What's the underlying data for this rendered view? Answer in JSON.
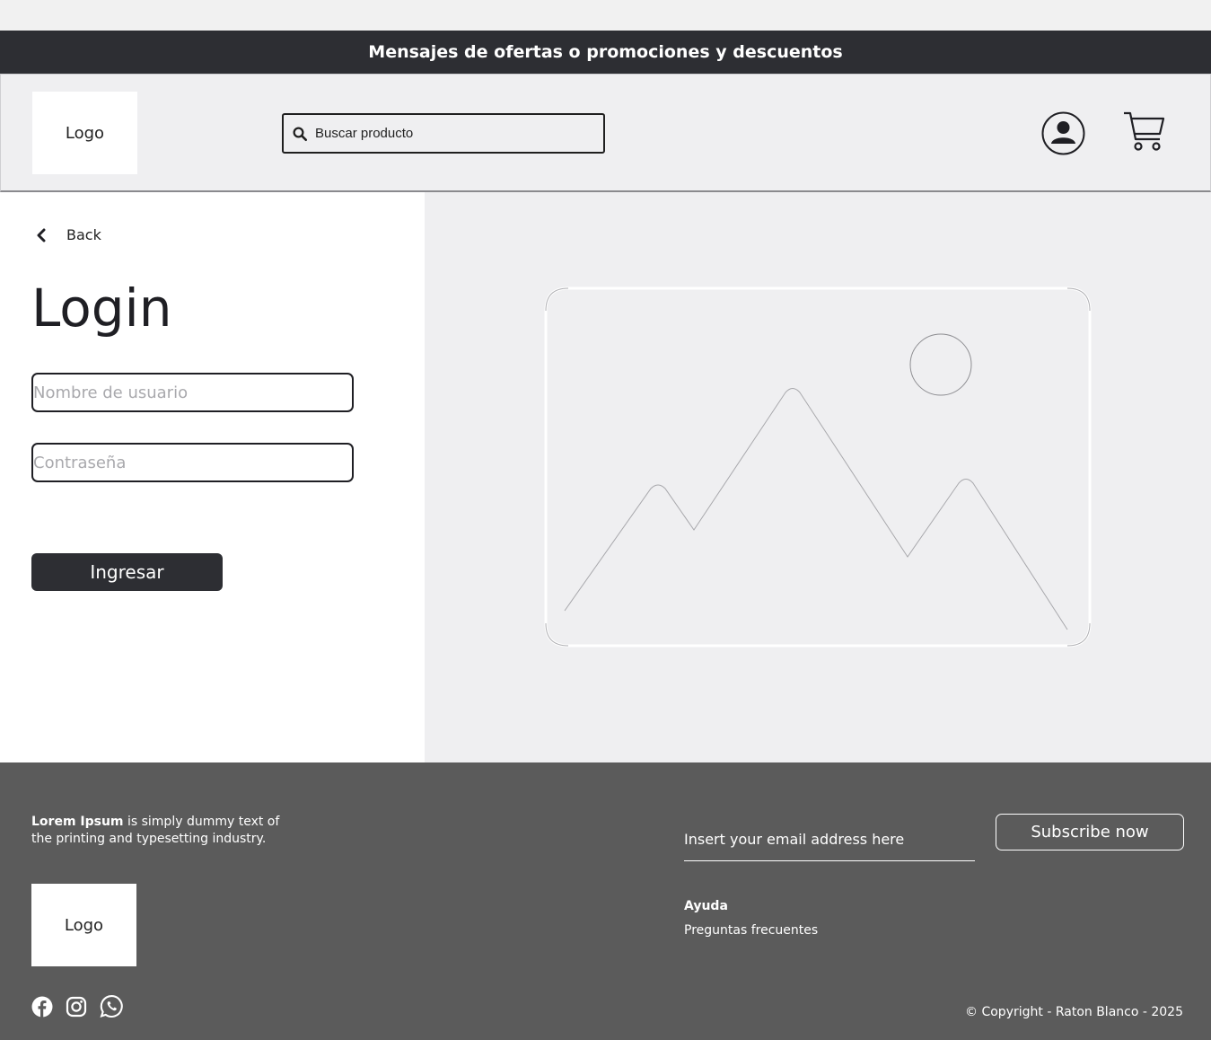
{
  "promo": {
    "text": "Mensajes de ofertas o promociones y descuentos"
  },
  "header": {
    "logo": "Logo",
    "search_placeholder": "Buscar producto",
    "icons": [
      "search-icon",
      "user-icon",
      "cart-icon"
    ]
  },
  "login": {
    "back_label": "Back",
    "title": "Login",
    "username_placeholder": "Nombre de usuario",
    "password_placeholder": "Contraseña",
    "submit_label": "Ingresar"
  },
  "footer": {
    "about_bold": "Lorem Ipsum",
    "about_rest": " is simply dummy text of the printing and typesetting industry.",
    "logo": "Logo",
    "socials": [
      "facebook-icon",
      "instagram-icon",
      "whatsapp-icon"
    ],
    "email_placeholder": "Insert your email address here",
    "subscribe_label": "Subscribe now",
    "help_title": "Ayuda",
    "help_link": "Preguntas frecuentes",
    "copyright": "© Copyright - Raton Blanco - 2025"
  },
  "colors": {
    "dark": "#2d2e33",
    "footer_bg": "#5b5b5b",
    "panel_bg": "#efeff1"
  }
}
